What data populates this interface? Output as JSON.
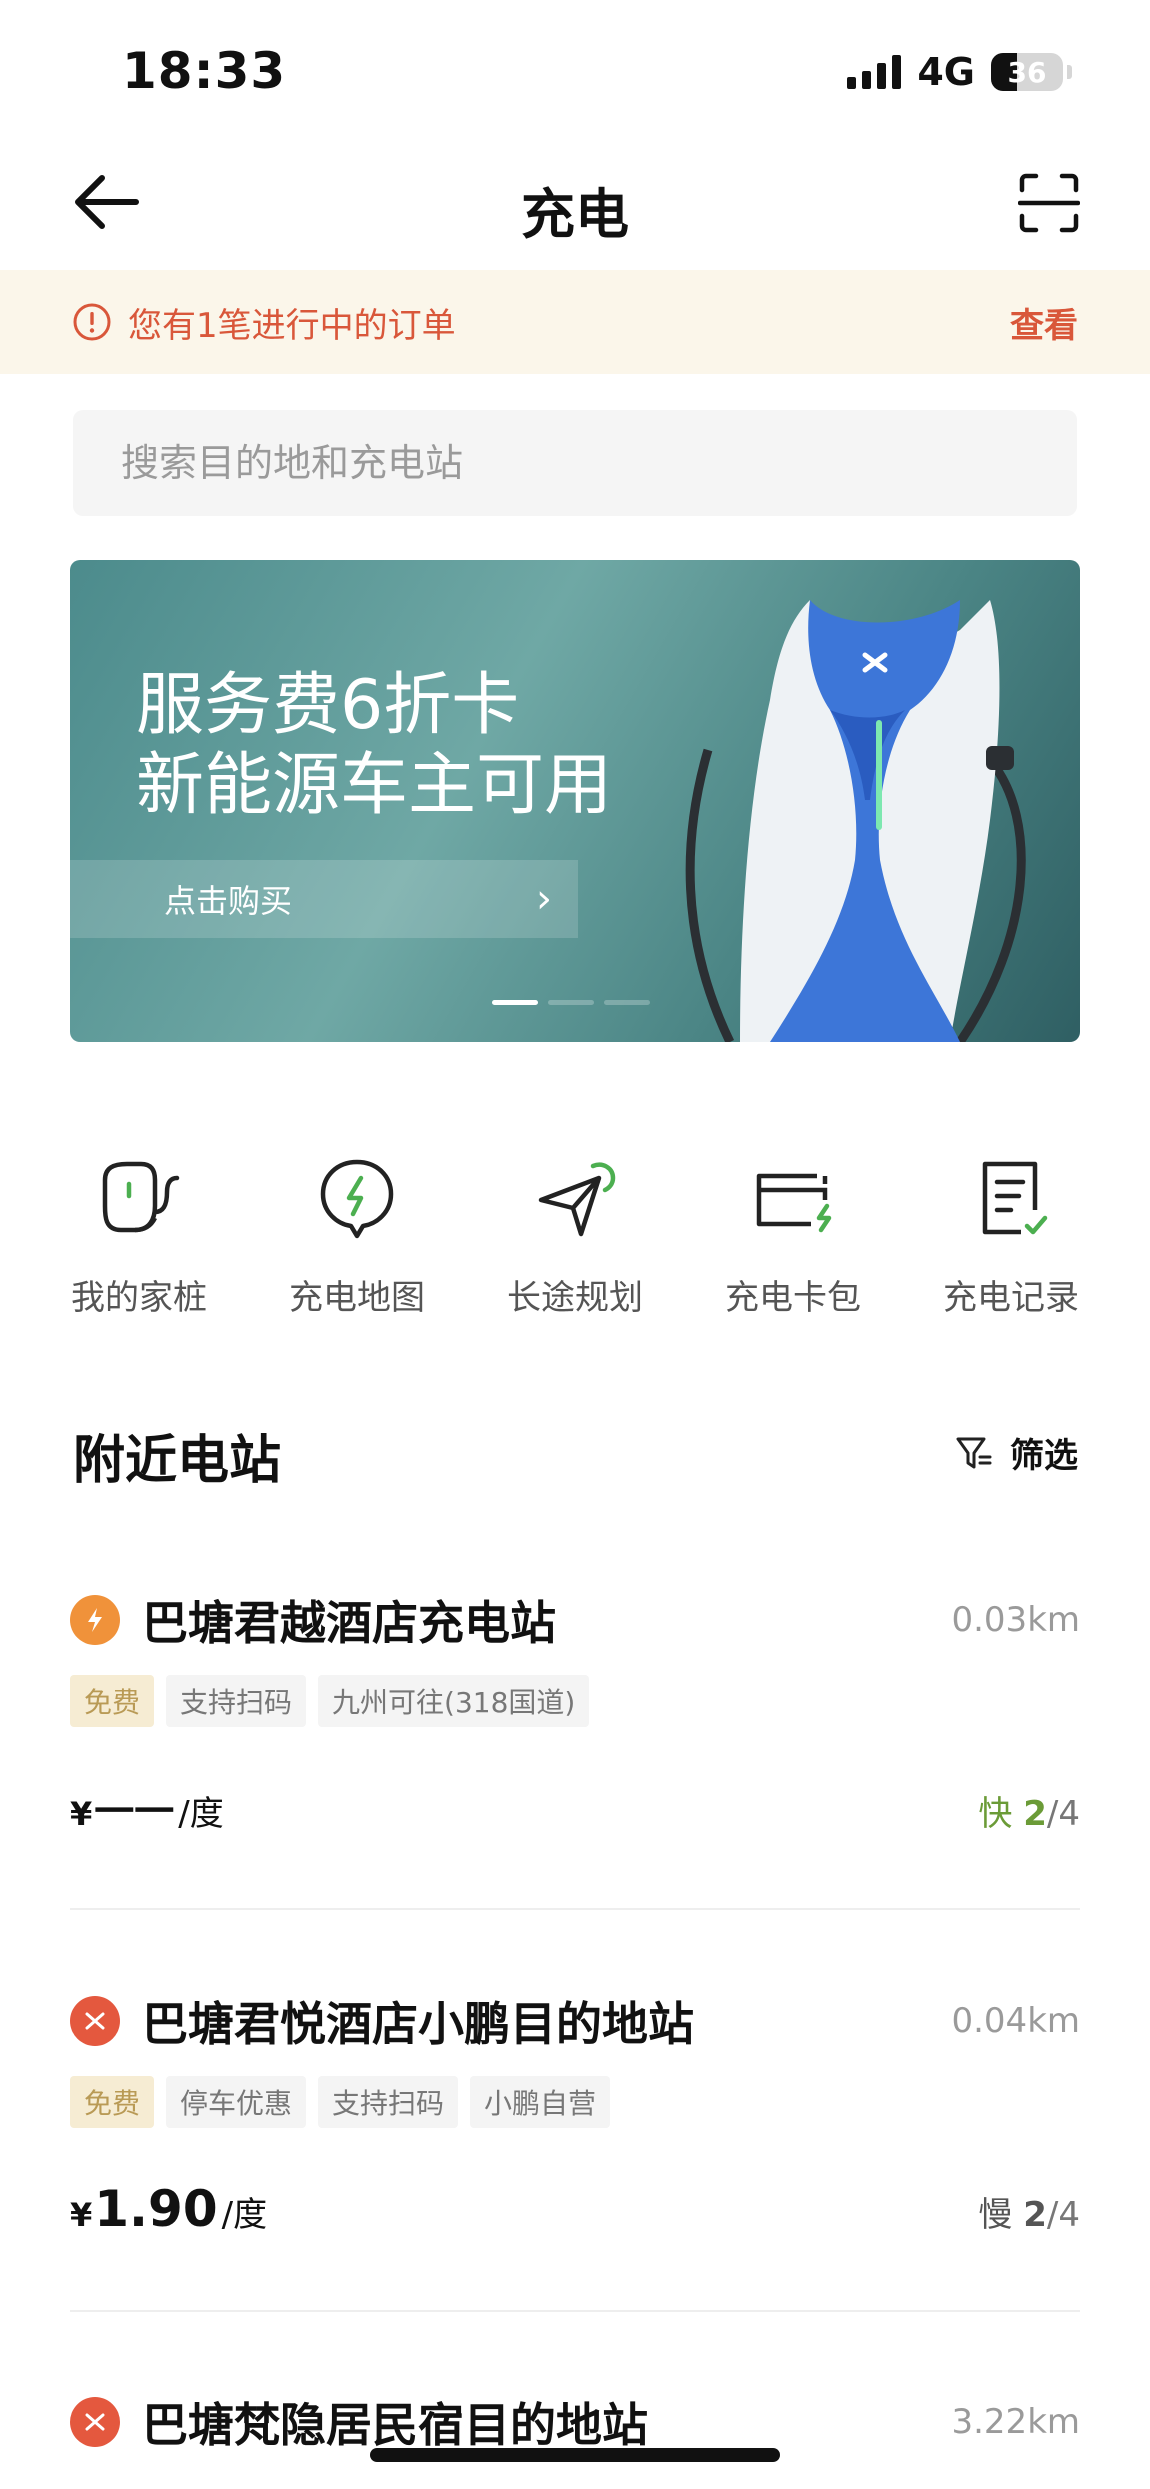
{
  "status": {
    "time": "18:33",
    "network": "4G",
    "battery": "36",
    "battery_level": 0.36
  },
  "nav": {
    "title": "充电"
  },
  "order": {
    "text": "您有1笔进行中的订单",
    "link": "查看"
  },
  "search": {
    "placeholder": "搜索目的地和充电站"
  },
  "banner": {
    "title_line1": "服务费6折卡",
    "title_line2": "新能源车主可用",
    "button": "点击购买",
    "slides": 3,
    "active_slide": 1
  },
  "menu": [
    {
      "label": "我的家桩",
      "icon": "home-charger-icon"
    },
    {
      "label": "充电地图",
      "icon": "charge-map-icon"
    },
    {
      "label": "长途规划",
      "icon": "route-plan-icon"
    },
    {
      "label": "充电卡包",
      "icon": "card-wallet-icon"
    },
    {
      "label": "充电记录",
      "icon": "charge-record-icon"
    }
  ],
  "nearby": {
    "title": "附近电站",
    "filter": "筛选",
    "stations": [
      {
        "name": "巴塘君越酒店充电站",
        "distance": "0.03km",
        "tags": [
          "免费",
          "支持扫码",
          "九州可往(318国道)"
        ],
        "price_symbol": "¥",
        "price": "一一",
        "unit": "/度",
        "kind": "快",
        "available": "2",
        "total": "/4",
        "icon_color": "#f0923a"
      },
      {
        "name": "巴塘君悦酒店小鹏目的地站",
        "distance": "0.04km",
        "tags": [
          "免费",
          "停车优惠",
          "支持扫码",
          "小鹏自营"
        ],
        "price_symbol": "¥",
        "price": "1.90",
        "unit": "/度",
        "kind": "慢",
        "available": "2",
        "total": "/4",
        "icon_color": "#e4583e"
      },
      {
        "name": "巴塘梵隐居民宿目的地站",
        "distance": "3.22km",
        "icon_color": "#e4583e"
      }
    ]
  }
}
